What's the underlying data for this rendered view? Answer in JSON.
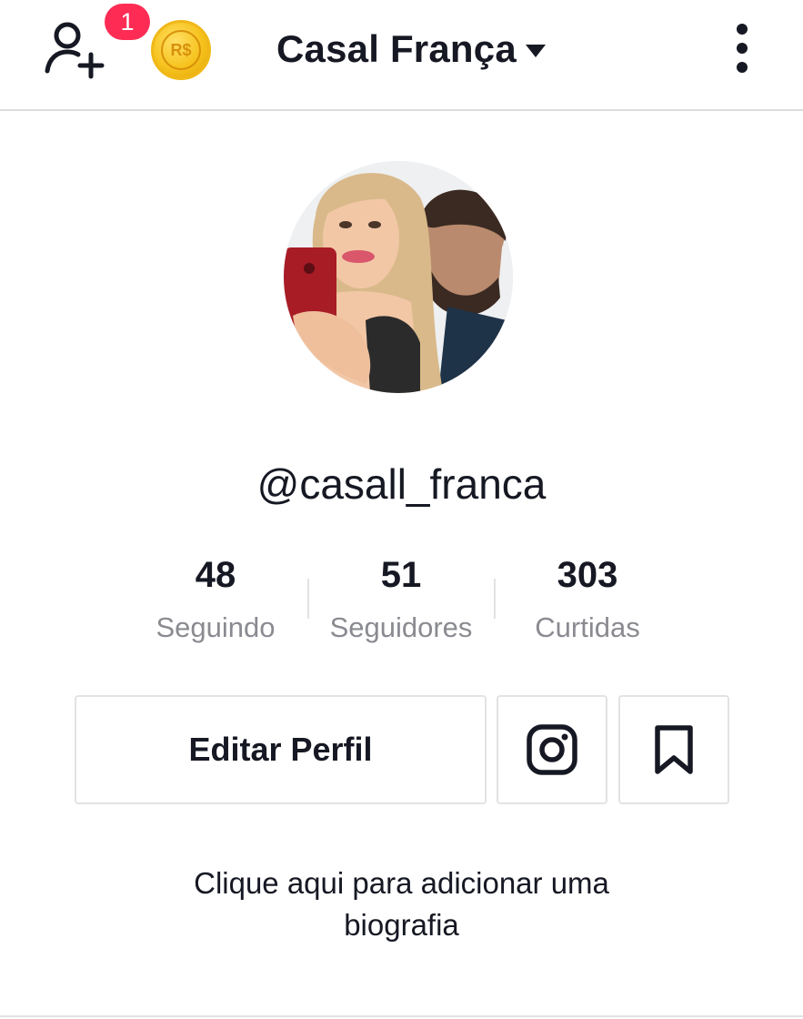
{
  "header": {
    "notification_count": "1",
    "coin_label": "R$",
    "account_name": "Casal França",
    "icons": {
      "add_friend": "add-friend-icon",
      "coin": "coin-icon",
      "caret": "caret-down-icon",
      "more": "more-vertical-icon"
    }
  },
  "profile": {
    "username": "@casall_franca",
    "avatar": "profile-photo"
  },
  "stats": [
    {
      "value": "48",
      "label": "Seguindo"
    },
    {
      "value": "51",
      "label": "Seguidores"
    },
    {
      "value": "303",
      "label": "Curtidas"
    }
  ],
  "actions": {
    "edit_profile_label": "Editar Perfil",
    "instagram_icon": "instagram-icon",
    "bookmark_icon": "bookmark-icon"
  },
  "bio": {
    "line1": "Clique aqui para adicionar uma",
    "line2": "biografia"
  },
  "colors": {
    "badge": "#fe2c55",
    "text_primary": "#161823",
    "text_secondary": "#8a8b91",
    "border": "#e3e3e4",
    "coin": "#f6c21c"
  }
}
